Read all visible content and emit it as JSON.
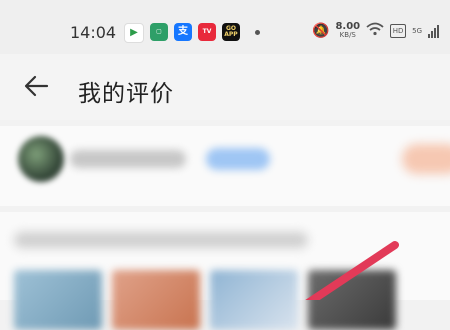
{
  "status_bar": {
    "time": "14:04",
    "net_speed": "8.00",
    "net_speed_unit": "KB/S",
    "hd_label": "HD",
    "network_label": "5G",
    "app_icons": [
      "play",
      "chat",
      "支",
      "TV",
      "GO APP"
    ]
  },
  "header": {
    "title": "我的评价",
    "back_icon": "back-arrow-icon"
  },
  "colors": {
    "annotation_stroke": "#e23a58",
    "tag_blue": "#9fc6f4",
    "button_orange": "#f6c8b2"
  }
}
